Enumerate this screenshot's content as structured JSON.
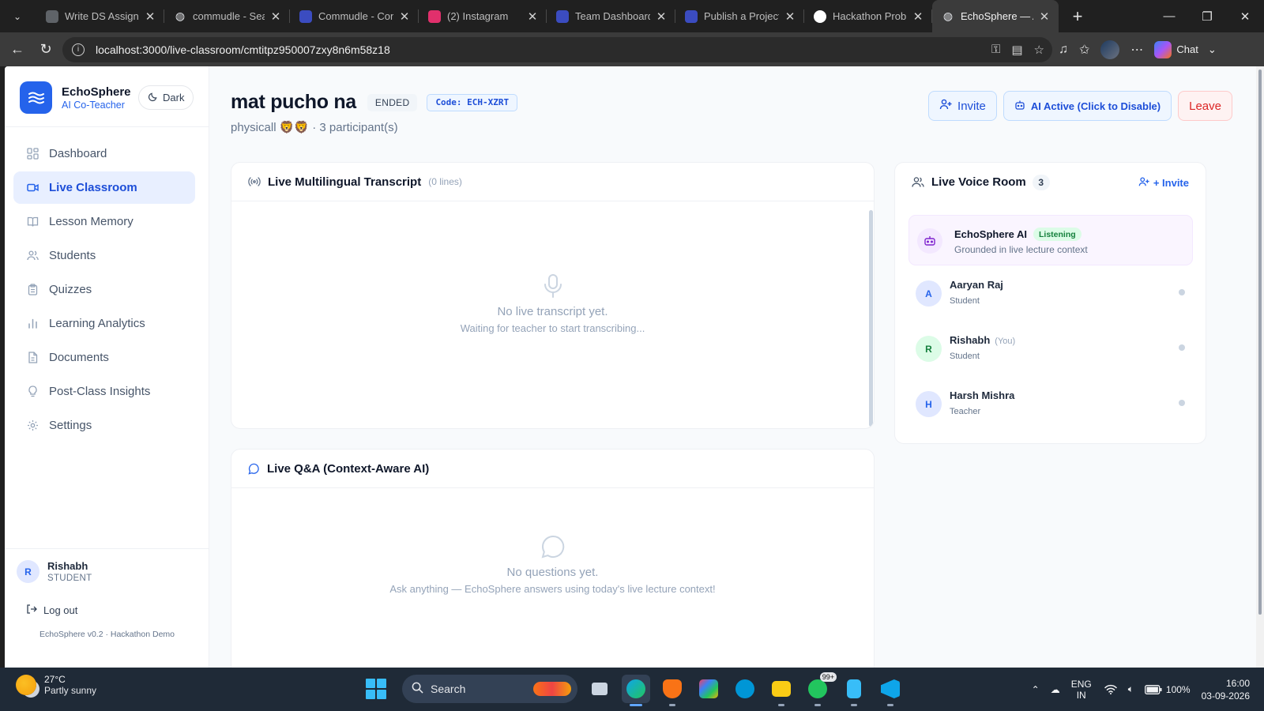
{
  "browser": {
    "tabs": [
      {
        "label": "Write DS Assignme",
        "favicon_color": "#5f6368",
        "favicon": "circle"
      },
      {
        "label": "commudle - Search",
        "favicon_color": "#e5e7eb",
        "favicon": "globe"
      },
      {
        "label": "Commudle - Conne",
        "favicon_color": "#3b4cc0",
        "favicon": "bars"
      },
      {
        "label": "(2) Instagram",
        "favicon_color": "#e1306c",
        "favicon": "instagram"
      },
      {
        "label": "Team Dashboard | I",
        "favicon_color": "#3b4cc0",
        "favicon": "bars"
      },
      {
        "label": "Publish a Project - I",
        "favicon_color": "#3b4cc0",
        "favicon": "bars"
      },
      {
        "label": "Hackathon Problem",
        "favicon_color": "#ffffff",
        "favicon": "openai"
      },
      {
        "label": "EchoSphere — AI C",
        "favicon_color": "#e5e7eb",
        "favicon": "globe",
        "active": true
      }
    ],
    "url": "localhost:3000/live-classroom/cmtitpz950007zxy8n6m58z18",
    "chat_label": "Chat"
  },
  "sidebar": {
    "brand_name": "EchoSphere",
    "brand_sub": "AI Co-Teacher",
    "theme_toggle": "Dark",
    "items": [
      {
        "label": "Dashboard",
        "icon": "grid-icon"
      },
      {
        "label": "Live Classroom",
        "icon": "video-icon",
        "active": true
      },
      {
        "label": "Lesson Memory",
        "icon": "book-icon"
      },
      {
        "label": "Students",
        "icon": "users-icon"
      },
      {
        "label": "Quizzes",
        "icon": "clipboard-icon"
      },
      {
        "label": "Learning Analytics",
        "icon": "bar-chart-icon"
      },
      {
        "label": "Documents",
        "icon": "document-icon"
      },
      {
        "label": "Post-Class Insights",
        "icon": "lightbulb-icon"
      },
      {
        "label": "Settings",
        "icon": "gear-icon"
      }
    ],
    "user": {
      "initial": "R",
      "name": "Rishabh",
      "role": "STUDENT"
    },
    "logout": "Log out",
    "version": "EchoSphere v0.2 · Hackathon Demo"
  },
  "header": {
    "title": "mat pucho na",
    "status": "ENDED",
    "code": "Code: ECH-XZRT",
    "subject": "physicall 🦁🦁",
    "participants": "· 3 participant(s)",
    "invite": "Invite",
    "ai_toggle": "AI Active (Click to Disable)",
    "leave": "Leave"
  },
  "transcript": {
    "title": "Live Multilingual Transcript",
    "meta": "(0 lines)",
    "empty_title": "No live transcript yet.",
    "empty_sub": "Waiting for teacher to start transcribing..."
  },
  "qa": {
    "title": "Live Q&A (Context-Aware AI)",
    "empty_title": "No questions yet.",
    "empty_sub": "Ask anything — EchoSphere answers using today's live lecture context!"
  },
  "voice_room": {
    "title": "Live Voice Room",
    "count": "3",
    "invite": "+ Invite",
    "ai": {
      "name": "EchoSphere AI",
      "badge": "Listening",
      "desc": "Grounded in live lecture context"
    },
    "participants": [
      {
        "initial": "A",
        "name": "Aaryan Raj",
        "you": "",
        "role": "Student",
        "bg": "#e0e7ff",
        "fg": "#2563eb"
      },
      {
        "initial": "R",
        "name": "Rishabh",
        "you": "(You)",
        "role": "Student",
        "bg": "#dcfce7",
        "fg": "#15803d"
      },
      {
        "initial": "H",
        "name": "Harsh Mishra",
        "you": "",
        "role": "Teacher",
        "bg": "#e0e7ff",
        "fg": "#2563eb"
      }
    ]
  },
  "taskbar": {
    "temp": "27°C",
    "weather": "Partly sunny",
    "search": "Search",
    "whatsapp_badge": "99+",
    "lang_top": "ENG",
    "lang_bottom": "IN",
    "battery": "100%",
    "time": "16:00",
    "date": "03-09-2026"
  }
}
